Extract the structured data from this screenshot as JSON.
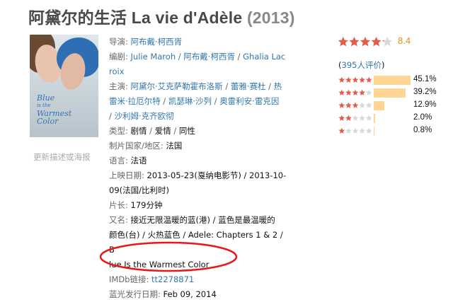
{
  "title": {
    "main": "阿黛尔的生活 La vie d'Adèle",
    "year": "(2013)"
  },
  "poster": {
    "title_line1": "Blue",
    "title_line2": "is the",
    "title_line3": "Warmest Color"
  },
  "update_link": "更新描述或海报",
  "info": {
    "director_label": "导演:",
    "director": [
      "阿布戴·柯西胥"
    ],
    "writer_label": "编剧:",
    "writers": [
      "Julie Maroh",
      "阿布戴·柯西胥",
      "Ghalia Lacroix"
    ],
    "writer_wrap": [
      "Ghalia Lac",
      "roix"
    ],
    "cast_label": "主演:",
    "cast_lines": [
      [
        "阿黛尔·艾克萨勒霍布洛斯",
        "蕾雅·赛杜",
        "热"
      ],
      [
        "雷米·拉厄尔特",
        "凯瑟琳·沙列",
        "奥雷利安·雷克因"
      ],
      [
        "沙利姆·克齐欧彻"
      ]
    ],
    "genre_label": "类型:",
    "genres": [
      "剧情",
      "爱情",
      "同性"
    ],
    "country_label": "制片国家/地区:",
    "country": "法国",
    "language_label": "语言:",
    "language": "法语",
    "release_label": "上映日期:",
    "release_line1": "2013-05-23(戛纳电影节) / 2013-10-",
    "release_line2": "09(法国/比利时)",
    "runtime_label": "片长:",
    "runtime": "179分钟",
    "aka_label": "又名:",
    "aka_lines": [
      "接近无限温暖的蓝(港) / 蓝色是最温暖的",
      "颜色(台) / 火热蓝色 / Adele: Chapters 1 & 2 / B",
      "lue Is the Warmest Color"
    ],
    "imdb_label": "IMDb链接:",
    "imdb": "tt2278871",
    "bluray_label": "蓝光发行日期:",
    "bluray": "Feb 09, 2014"
  },
  "rating": {
    "score": "8.4",
    "stars_filled_fraction": 0.84,
    "votes_count": "395人评价",
    "votes_open": "(",
    "votes_close": ")",
    "distribution": [
      {
        "stars": 5,
        "percent": "45.1%",
        "value": 45.1
      },
      {
        "stars": 4,
        "percent": "39.2%",
        "value": 39.2
      },
      {
        "stars": 3,
        "percent": "12.9%",
        "value": 12.9
      },
      {
        "stars": 2,
        "percent": "2.0%",
        "value": 2.0
      },
      {
        "stars": 1,
        "percent": "0.8%",
        "value": 0.8
      }
    ]
  },
  "colors": {
    "link": "#3377aa",
    "star": "#e55c4c",
    "star_empty": "#d9d9d9",
    "bar": "#ffd596",
    "score": "#e09015",
    "annotation": "#e8171a"
  }
}
